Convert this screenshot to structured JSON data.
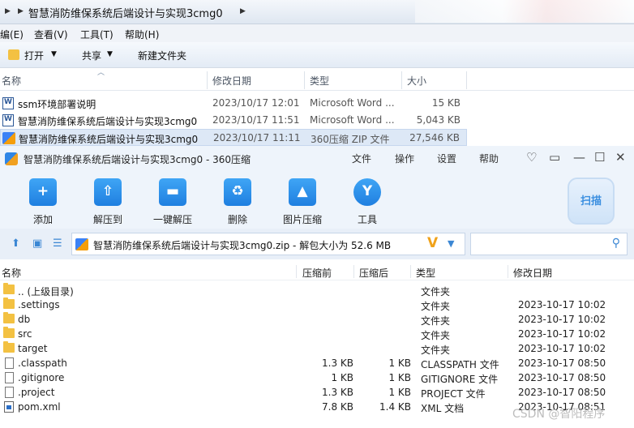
{
  "explorer": {
    "breadcrumb": "智慧消防维保系统后端设计与实现3cmg0",
    "menus": [
      "编(E)",
      "查看(V)",
      "工具(T)",
      "帮助(H)"
    ],
    "toolbar": {
      "open": "打开",
      "share": "共享",
      "new_folder": "新建文件夹"
    },
    "columns": {
      "name": "名称",
      "date": "修改日期",
      "type": "类型",
      "size": "大小"
    },
    "files": [
      {
        "name": "ssm环境部署说明",
        "date": "2023/10/17 12:01",
        "type": "Microsoft Word ...",
        "size": "15 KB",
        "icon": "word-icon"
      },
      {
        "name": "智慧消防维保系统后端设计与实现3cmg0",
        "date": "2023/10/17 11:51",
        "type": "Microsoft Word ...",
        "size": "5,043 KB",
        "icon": "word-icon"
      },
      {
        "name": "智慧消防维保系统后端设计与实现3cmg0",
        "date": "2023/10/17 11:11",
        "type": "360压缩 ZIP 文件",
        "size": "27,546 KB",
        "icon": "zip-icon"
      }
    ]
  },
  "zip360": {
    "title": "智慧消防维保系统后端设计与实现3cmg0 - 360压缩",
    "menu": [
      "文件",
      "操作",
      "设置",
      "帮助"
    ],
    "ribbon": [
      "添加",
      "解压到",
      "一键解压",
      "删除",
      "图片压缩",
      "工具"
    ],
    "scan_label": "扫描",
    "path": "智慧消防维保系统后端设计与实现3cmg0.zip - 解包大小为 52.6 MB",
    "columns": {
      "name": "名称",
      "compressed": "压缩前",
      "after": "压缩后",
      "type": "类型",
      "modified": "修改日期"
    },
    "rows": [
      {
        "name": ".. (上级目录)",
        "before": "",
        "after": "",
        "type": "文件夹",
        "modified": "",
        "icon": "folder"
      },
      {
        "name": ".settings",
        "before": "",
        "after": "",
        "type": "文件夹",
        "modified": "2023-10-17 10:02",
        "icon": "folder"
      },
      {
        "name": "db",
        "before": "",
        "after": "",
        "type": "文件夹",
        "modified": "2023-10-17 10:02",
        "icon": "folder"
      },
      {
        "name": "src",
        "before": "",
        "after": "",
        "type": "文件夹",
        "modified": "2023-10-17 10:02",
        "icon": "folder"
      },
      {
        "name": "target",
        "before": "",
        "after": "",
        "type": "文件夹",
        "modified": "2023-10-17 10:02",
        "icon": "folder"
      },
      {
        "name": ".classpath",
        "before": "1.3 KB",
        "after": "1 KB",
        "type": "CLASSPATH 文件",
        "modified": "2023-10-17 08:50",
        "icon": "file"
      },
      {
        "name": ".gitignore",
        "before": "1 KB",
        "after": "1 KB",
        "type": "GITIGNORE 文件",
        "modified": "2023-10-17 08:50",
        "icon": "file"
      },
      {
        "name": ".project",
        "before": "1.3 KB",
        "after": "1 KB",
        "type": "PROJECT 文件",
        "modified": "2023-10-17 08:50",
        "icon": "file"
      },
      {
        "name": "pom.xml",
        "before": "7.8 KB",
        "after": "1.4 KB",
        "type": "XML 文档",
        "modified": "2023-10-17 08:51",
        "icon": "xml"
      }
    ]
  },
  "watermark": "CSDN @智阳程序"
}
